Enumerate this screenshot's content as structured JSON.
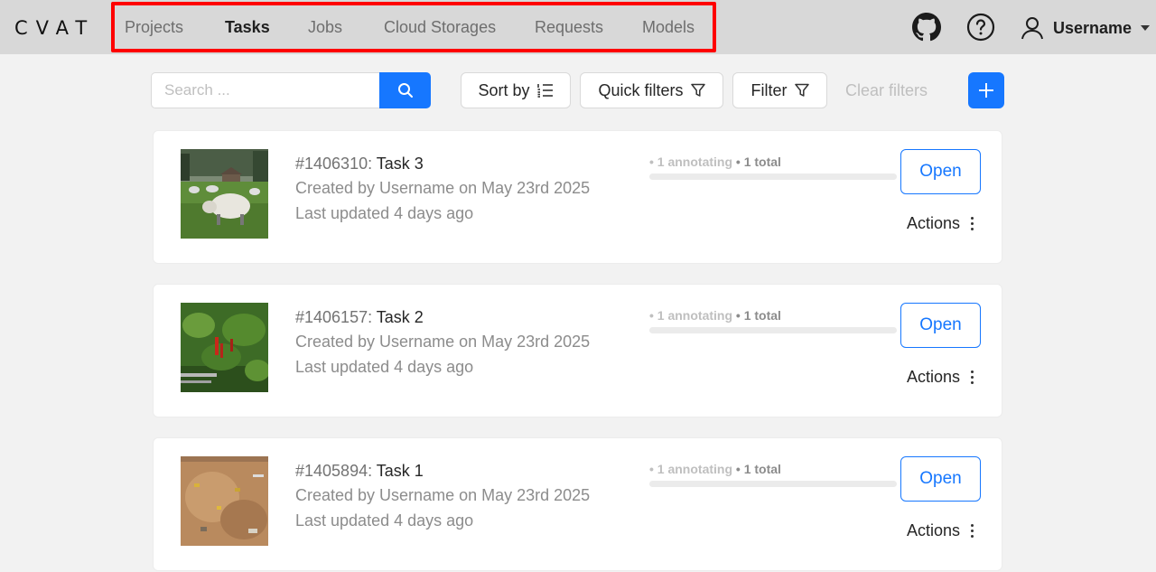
{
  "header": {
    "logo": "CVAT",
    "nav": [
      {
        "label": "Projects",
        "active": false
      },
      {
        "label": "Tasks",
        "active": true
      },
      {
        "label": "Jobs",
        "active": false
      },
      {
        "label": "Cloud Storages",
        "active": false
      },
      {
        "label": "Requests",
        "active": false
      },
      {
        "label": "Models",
        "active": false
      }
    ],
    "github_icon": "github-icon",
    "help_icon": "question-circle-icon",
    "user_icon": "user-icon",
    "username": "Username"
  },
  "toolbar": {
    "search_placeholder": "Search ...",
    "sort_label": "Sort by",
    "quick_filters_label": "Quick filters",
    "filter_label": "Filter",
    "clear_filters_label": "Clear filters"
  },
  "colors": {
    "accent": "#1677ff",
    "highlight": "#ff0000"
  },
  "tasks": [
    {
      "id": "#1406310:",
      "name": "Task 3",
      "created": "Created by Username on May 23rd 2025",
      "updated": "Last updated 4 days ago",
      "status": "• 1 annotating",
      "total": "• 1 total",
      "open_label": "Open",
      "actions_label": "Actions"
    },
    {
      "id": "#1406157:",
      "name": "Task 2",
      "created": "Created by Username on May 23rd 2025",
      "updated": "Last updated 4 days ago",
      "status": "• 1 annotating",
      "total": "• 1 total",
      "open_label": "Open",
      "actions_label": "Actions"
    },
    {
      "id": "#1405894:",
      "name": "Task 1",
      "created": "Created by Username on May 23rd 2025",
      "updated": "Last updated 4 days ago",
      "status": "• 1 annotating",
      "total": "• 1 total",
      "open_label": "Open",
      "actions_label": "Actions"
    }
  ]
}
